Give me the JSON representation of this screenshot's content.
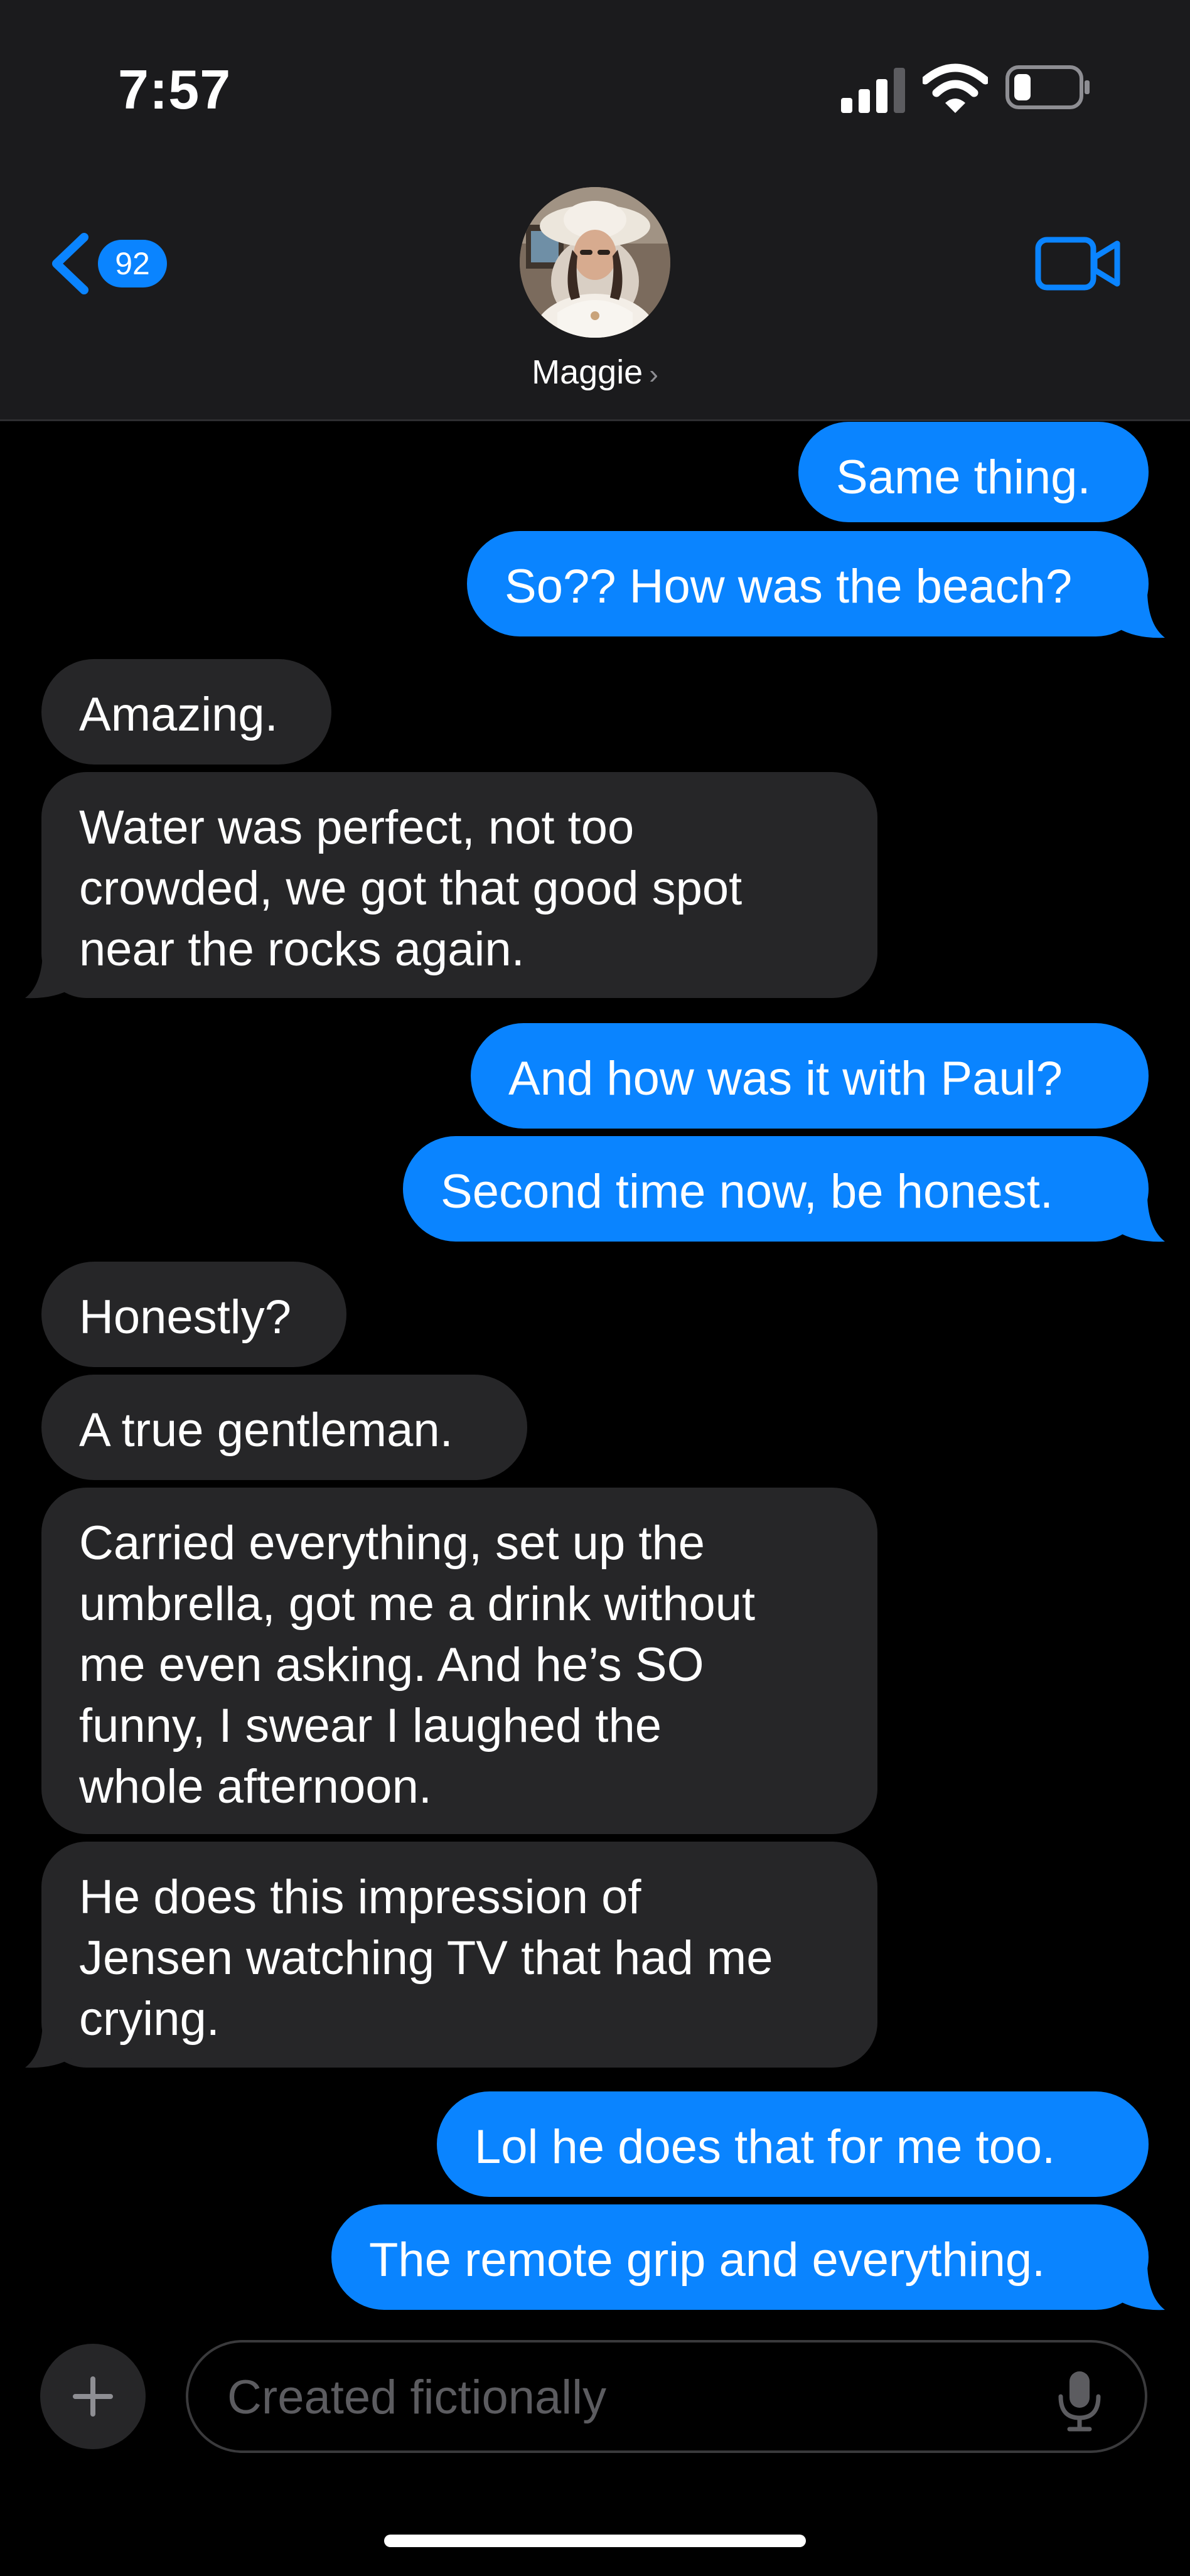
{
  "status_bar": {
    "time": "7:57"
  },
  "header": {
    "back_badge": "92",
    "contact_name": "Maggie",
    "name_chevron": "›"
  },
  "messages": [
    {
      "sender": "me",
      "text": "Same thing."
    },
    {
      "sender": "me",
      "text": "So?? How was the beach?"
    },
    {
      "sender": "them",
      "text": "Amazing."
    },
    {
      "sender": "them",
      "text": "Water was perfect, not too\ncrowded, we got that good spot\nnear the rocks again."
    },
    {
      "sender": "me",
      "text": "And how was it with Paul?"
    },
    {
      "sender": "me",
      "text": "Second time now, be honest."
    },
    {
      "sender": "them",
      "text": "Honestly?"
    },
    {
      "sender": "them",
      "text": "A true gentleman."
    },
    {
      "sender": "them",
      "text": "Carried everything, set up the\numbrella, got me a drink without\nme even asking. And he’s SO\nfunny, I swear I laughed the\nwhole afternoon."
    },
    {
      "sender": "them",
      "text": "He does this impression of\nJensen watching TV that had me\ncrying."
    },
    {
      "sender": "me",
      "text": "Lol he does that for me too."
    },
    {
      "sender": "me",
      "text": "The remote grip and everything."
    }
  ],
  "composer": {
    "placeholder": "Created fictionally"
  },
  "colors": {
    "accent": "#0a84ff",
    "outgoing_bubble": "#0a84ff",
    "incoming_bubble": "#262628",
    "header_background": "#1b1b1d",
    "background": "#000000"
  },
  "icons": {
    "back": "chevron-left-icon",
    "video": "video-camera-icon",
    "add": "plus-icon",
    "mic": "microphone-icon"
  }
}
